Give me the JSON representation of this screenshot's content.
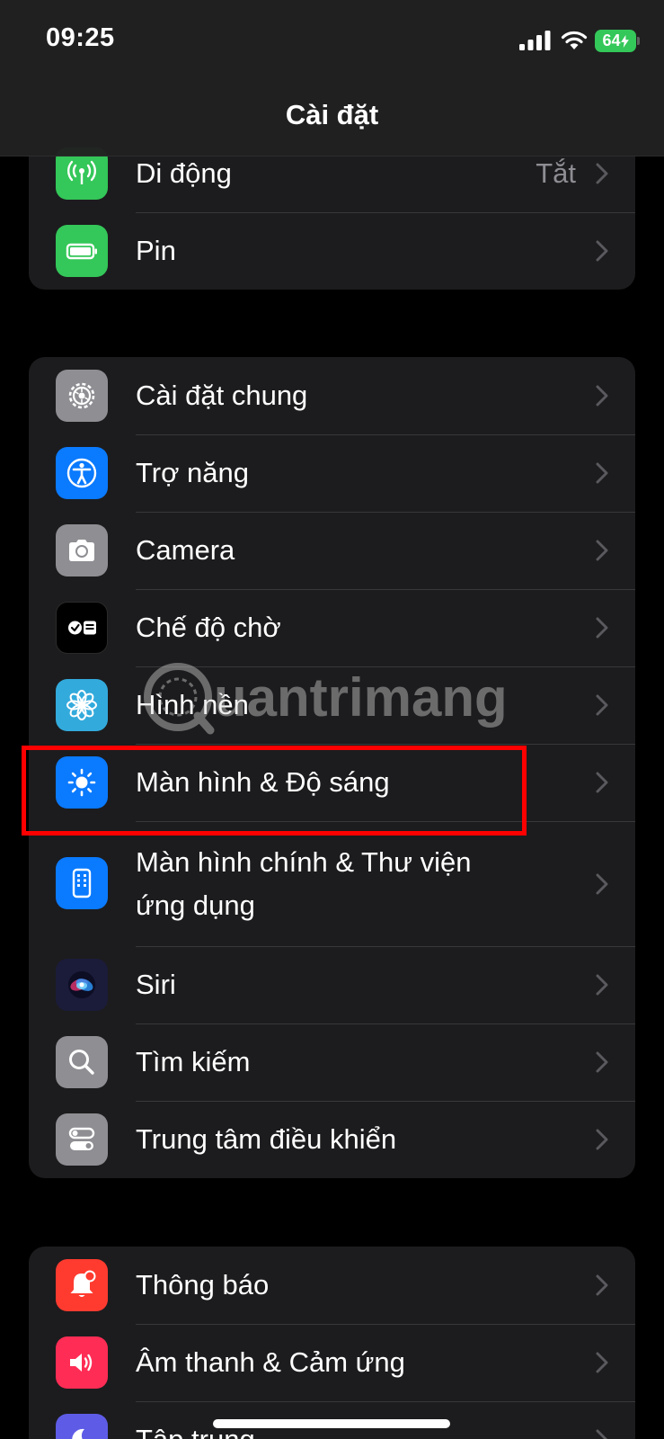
{
  "status": {
    "time": "09:25",
    "battery": "64"
  },
  "header": {
    "title": "Cài đặt"
  },
  "group1": [
    {
      "label": "Di động",
      "value": "Tắt",
      "icon": "cellular-antenna-icon",
      "color": "#34c759"
    },
    {
      "label": "Pin",
      "icon": "battery-icon",
      "color": "#34c759"
    }
  ],
  "group2": [
    {
      "label": "Cài đặt chung",
      "icon": "gear-icon",
      "color": "#8e8e93"
    },
    {
      "label": "Trợ năng",
      "icon": "accessibility-icon",
      "color": "#0a7aff"
    },
    {
      "label": "Camera",
      "icon": "camera-icon",
      "color": "#8e8e93"
    },
    {
      "label": "Chế độ chờ",
      "icon": "standby-icon",
      "color": "#000000"
    },
    {
      "label": "Hình nền",
      "icon": "flower-icon",
      "color": "#33aadc"
    },
    {
      "label": "Màn hình & Độ sáng",
      "icon": "sun-icon",
      "color": "#0a7aff"
    },
    {
      "label": "Màn hình chính & Thư viện ứng dụng",
      "icon": "home-screen-icon",
      "color": "#0a7aff"
    },
    {
      "label": "Siri",
      "icon": "siri-icon",
      "color": "#1b1b3a"
    },
    {
      "label": "Tìm kiếm",
      "icon": "search-icon",
      "color": "#8e8e93"
    },
    {
      "label": "Trung tâm điều khiển",
      "icon": "toggles-icon",
      "color": "#8e8e93"
    }
  ],
  "group3": [
    {
      "label": "Thông báo",
      "icon": "bell-icon",
      "color": "#ff3b30"
    },
    {
      "label": "Âm thanh & Cảm ứng",
      "icon": "speaker-icon",
      "color": "#ff2d55"
    },
    {
      "label": "Tập trung",
      "icon": "moon-icon",
      "color": "#5e5ce6"
    }
  ],
  "watermark": {
    "text": "uantrimang"
  }
}
